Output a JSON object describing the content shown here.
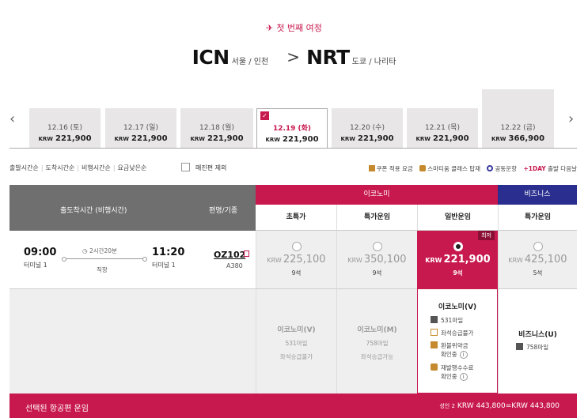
{
  "header": {
    "trip_label": "첫 번째 여정",
    "origin_code": "ICN",
    "origin_city": "서울 / 인천",
    "dest_code": "NRT",
    "dest_city": "도쿄 / 나리타",
    "arrow": ">"
  },
  "dates": [
    {
      "date": "12.16 (토)",
      "currency": "KRW",
      "price": "221,900"
    },
    {
      "date": "12.17 (일)",
      "currency": "KRW",
      "price": "221,900"
    },
    {
      "date": "12.18 (월)",
      "currency": "KRW",
      "price": "221,900"
    },
    {
      "date": "12.19 (화)",
      "currency": "KRW",
      "price": "221,900",
      "selected": true
    },
    {
      "date": "12.20 (수)",
      "currency": "KRW",
      "price": "221,900"
    },
    {
      "date": "12.21 (목)",
      "currency": "KRW",
      "price": "221,900"
    },
    {
      "date": "12.22 (금)",
      "currency": "KRW",
      "price": "366,900"
    }
  ],
  "sort": {
    "options": [
      "출발시간순",
      "도착시간순",
      "비행시간순",
      "요금낮은순"
    ],
    "exclude_label": "매진편 제외"
  },
  "legend": {
    "coupon": "쿠폰 적용 요금",
    "smarty": "스마티움 클래스 탑재",
    "codeshare": "공동운항",
    "oneday_badge": "+1DAY",
    "oneday_text": "출발 다음날"
  },
  "table": {
    "col_time": "출도착시간 (비행시간)",
    "col_flight": "편명/기종",
    "economy": "이코노미",
    "business": "비즈니스",
    "fare_types": [
      "초특가",
      "특가운임",
      "일반운임",
      "특가운임"
    ]
  },
  "flight": {
    "dep_time": "09:00",
    "dep_terminal": "터미널 1",
    "duration": "2시간20분",
    "direct": "직항",
    "arr_time": "11:20",
    "arr_terminal": "터미널 1",
    "flight_no": "OZ102",
    "aircraft": "A380",
    "fares": [
      {
        "currency": "KRW",
        "price": "225,100",
        "seats": "9석"
      },
      {
        "currency": "KRW",
        "price": "350,100",
        "seats": "9석"
      },
      {
        "currency": "KRW",
        "price": "221,900",
        "seats": "9석",
        "selected": true,
        "badge": "최저"
      },
      {
        "currency": "KRW",
        "price": "425,100",
        "seats": "5석"
      }
    ]
  },
  "details": {
    "eco_v": {
      "name": "이코노미(V)",
      "mile": "531마일",
      "seat": "좌석승급불가"
    },
    "eco_m": {
      "name": "이코노미(M)",
      "mile": "758마일",
      "seat": "좌석승급가능"
    },
    "selected": {
      "name": "이코노미(V)",
      "mile": "531마일",
      "seat": "좌석승급불가",
      "refund_1": "환불위약금",
      "refund_2": "확인중",
      "change_1": "재발행수수료",
      "change_2": "확인중"
    },
    "biz_u": {
      "name": "비즈니스(U)",
      "mile": "758마일"
    }
  },
  "footer": {
    "label": "선택된 항공편 운임",
    "pax": "성인 2",
    "total": "KRW 443,800=KRW 443,800"
  }
}
